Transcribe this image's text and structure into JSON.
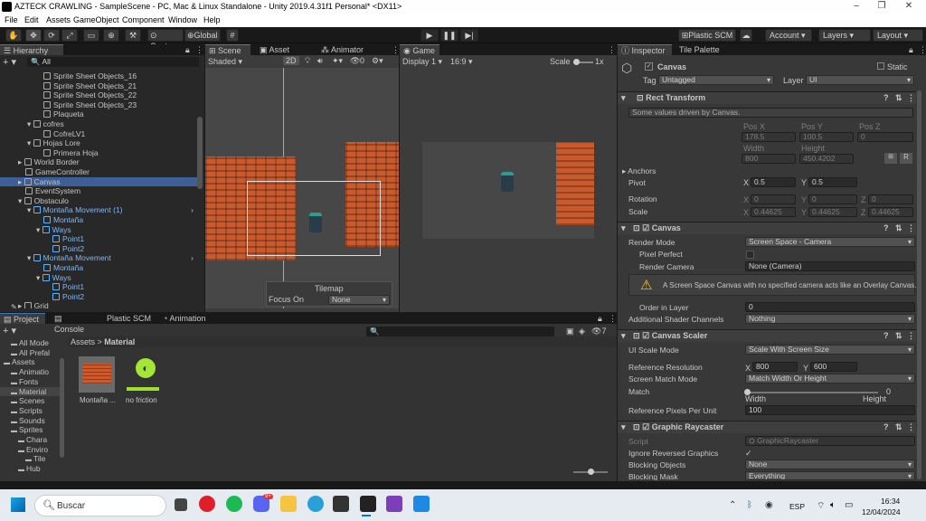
{
  "window": {
    "title": "AZTECK CRAWLING - SampleScene - PC, Mac & Linux Standalone - Unity 2019.4.31f1 Personal* <DX11>"
  },
  "menu": [
    "File",
    "Edit",
    "Assets",
    "GameObject",
    "Component",
    "Window",
    "Help"
  ],
  "toolbar": {
    "center": "Center",
    "global": "Global",
    "plastic": "Plastic SCM",
    "account": "Account",
    "layers": "Layers",
    "layout": "Layout"
  },
  "hierarchy": {
    "tab": "Hierarchy",
    "search": "All",
    "items": [
      {
        "label": "Sprite Sheet Objects_16",
        "indent": 4,
        "arrow": ""
      },
      {
        "label": "Sprite Sheet Objects_21",
        "indent": 4,
        "arrow": ""
      },
      {
        "label": "Sprite Sheet Objects_22",
        "indent": 4,
        "arrow": ""
      },
      {
        "label": "Sprite Sheet Objects_23",
        "indent": 4,
        "arrow": ""
      },
      {
        "label": "Plaqueta",
        "indent": 4,
        "arrow": ""
      },
      {
        "label": "cofres",
        "indent": 3,
        "arrow": "▾"
      },
      {
        "label": "CofreLV1",
        "indent": 4,
        "arrow": ""
      },
      {
        "label": "Hojas Lore",
        "indent": 3,
        "arrow": "▾"
      },
      {
        "label": "Primera Hoja",
        "indent": 4,
        "arrow": ""
      },
      {
        "label": "World Border",
        "indent": 2,
        "arrow": "▸"
      },
      {
        "label": "GameController",
        "indent": 2,
        "arrow": ""
      },
      {
        "label": "Canvas",
        "indent": 2,
        "arrow": "▸",
        "selected": true
      },
      {
        "label": "EventSystem",
        "indent": 2,
        "arrow": ""
      },
      {
        "label": "Obstaculo",
        "indent": 2,
        "arrow": "▾"
      },
      {
        "label": "Montaña Movement (1)",
        "indent": 3,
        "arrow": "▾",
        "prefab": true
      },
      {
        "label": "Montaña",
        "indent": 4,
        "arrow": "",
        "prefab": true
      },
      {
        "label": "Ways",
        "indent": 4,
        "arrow": "▾",
        "prefab": true
      },
      {
        "label": "Point1",
        "indent": 5,
        "arrow": "",
        "prefab": true
      },
      {
        "label": "Point2",
        "indent": 5,
        "arrow": "",
        "prefab": true
      },
      {
        "label": "Montaña Movement",
        "indent": 3,
        "arrow": "▾",
        "prefab": true
      },
      {
        "label": "Montaña",
        "indent": 4,
        "arrow": "",
        "prefab": true
      },
      {
        "label": "Ways",
        "indent": 4,
        "arrow": "▾",
        "prefab": true
      },
      {
        "label": "Point1",
        "indent": 5,
        "arrow": "",
        "prefab": true
      },
      {
        "label": "Point2",
        "indent": 5,
        "arrow": "",
        "prefab": true
      },
      {
        "label": "Grid",
        "indent": 2,
        "arrow": "▸"
      }
    ]
  },
  "scene": {
    "tabs": [
      "Scene",
      "Asset Store",
      "Animator"
    ],
    "shading": "Shaded",
    "mode2d": "2D",
    "gizmo_count": "0",
    "tilemap_title": "Tilemap",
    "focus_label": "Focus On",
    "focus_value": "None"
  },
  "game": {
    "tab": "Game",
    "display": "Display 1",
    "aspect": "16:9",
    "scale_label": "Scale",
    "scale_value": "1x"
  },
  "project": {
    "tabs": [
      "Project",
      "Console",
      "Plastic SCM",
      "Animation"
    ],
    "breadcrumb_root": "Assets",
    "breadcrumb_leaf": "Material",
    "count": "7",
    "tree": [
      {
        "label": "All Mode",
        "indent": 1
      },
      {
        "label": "All Prefal",
        "indent": 1
      },
      {
        "label": "Assets",
        "indent": 0
      },
      {
        "label": "Animatio",
        "indent": 1
      },
      {
        "label": "Fonts",
        "indent": 1
      },
      {
        "label": "Material",
        "indent": 1,
        "selected": true
      },
      {
        "label": "Scenes",
        "indent": 1
      },
      {
        "label": "Scripts",
        "indent": 1
      },
      {
        "label": "Sounds",
        "indent": 1
      },
      {
        "label": "Sprites",
        "indent": 1
      },
      {
        "label": "Chara",
        "indent": 2
      },
      {
        "label": "Enviro",
        "indent": 2
      },
      {
        "label": "Tile",
        "indent": 3
      },
      {
        "label": "Hub",
        "indent": 2
      }
    ],
    "assets": [
      {
        "label": "Montaña ..."
      },
      {
        "label": "no friction"
      }
    ]
  },
  "inspector": {
    "tabs": [
      "Inspector",
      "Tile Palette"
    ],
    "object_name": "Canvas",
    "static": "Static",
    "tag_label": "Tag",
    "tag": "Untagged",
    "layer_label": "Layer",
    "layer": "UI",
    "rect": {
      "title": "Rect Transform",
      "note": "Some values driven by Canvas.",
      "posx_l": "Pos X",
      "posy_l": "Pos Y",
      "posz_l": "Pos Z",
      "posx": "178.5",
      "posy": "100.5",
      "posz": "0",
      "w_l": "Width",
      "h_l": "Height",
      "w": "800",
      "h": "450.4202",
      "anchors": "Anchors",
      "pivot": "Pivot",
      "pivx": "0.5",
      "pivy": "0.5",
      "rotation": "Rotation",
      "rx": "0",
      "ry": "0",
      "rz": "0",
      "scale": "Scale",
      "sx": "0.44625",
      "sy": "0.44625",
      "sz": "0.44625"
    },
    "canvas": {
      "title": "Canvas",
      "render_mode_l": "Render Mode",
      "render_mode": "Screen Space - Camera",
      "pixel_perfect": "Pixel Perfect",
      "render_camera_l": "Render Camera",
      "render_camera": "None (Camera)",
      "warning": "A Screen Space Canvas with no specified camera acts like an Overlay Canvas.",
      "order_l": "Order in Layer",
      "order": "0",
      "shader_l": "Additional Shader Channels",
      "shader": "Nothing"
    },
    "scaler": {
      "title": "Canvas Scaler",
      "ui_scale_l": "UI Scale Mode",
      "ui_scale": "Scale With Screen Size",
      "ref_res_l": "Reference Resolution",
      "rx": "800",
      "ry": "600",
      "match_mode_l": "Screen Match Mode",
      "match_mode": "Match Width Or Height",
      "match_l": "Match",
      "match": "0",
      "width": "Width",
      "height": "Height",
      "ppu_l": "Reference Pixels Per Unit",
      "ppu": "100"
    },
    "raycaster": {
      "title": "Graphic Raycaster",
      "script_l": "Script",
      "script": "GraphicRaycaster",
      "ignore_l": "Ignore Reversed Graphics",
      "blocking_l": "Blocking Objects",
      "blocking": "None",
      "mask_l": "Blocking Mask",
      "mask": "Everything"
    }
  },
  "taskbar": {
    "search": "Buscar",
    "lang": "ESP",
    "time": "16:34",
    "date": "12/04/2024",
    "notif": "9+"
  },
  "colors": {
    "accent": "#3a79bb",
    "selection": "#3e5f96",
    "brick": "#c95a2e"
  }
}
